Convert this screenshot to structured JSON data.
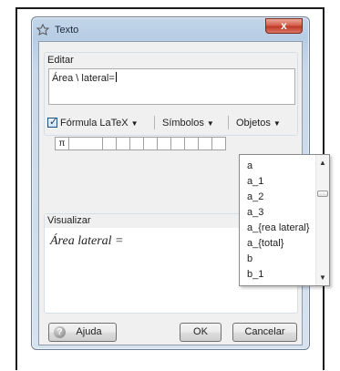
{
  "window": {
    "title": "Texto",
    "close_label": "x"
  },
  "edit": {
    "section_label": "Editar",
    "value": "Área \\ lateral="
  },
  "toolbar": {
    "latex_checked": true,
    "latex_label": "Fórmula LaTeX",
    "symbols_label": "Símbolos",
    "objects_label": "Objetos",
    "arrow": "▼"
  },
  "symbols": {
    "first": "π"
  },
  "preview": {
    "section_label": "Visualizar",
    "text": "Área lateral ="
  },
  "buttons": {
    "help": "Ajuda",
    "ok": "OK",
    "cancel": "Cancelar"
  },
  "objects_dropdown": {
    "items": [
      "a",
      "a_1",
      "a_2",
      "a_3",
      "a_{rea lateral}",
      "a_{total}",
      "b",
      "b_1"
    ],
    "scroll_up": "▲",
    "scroll_down": "▼"
  }
}
